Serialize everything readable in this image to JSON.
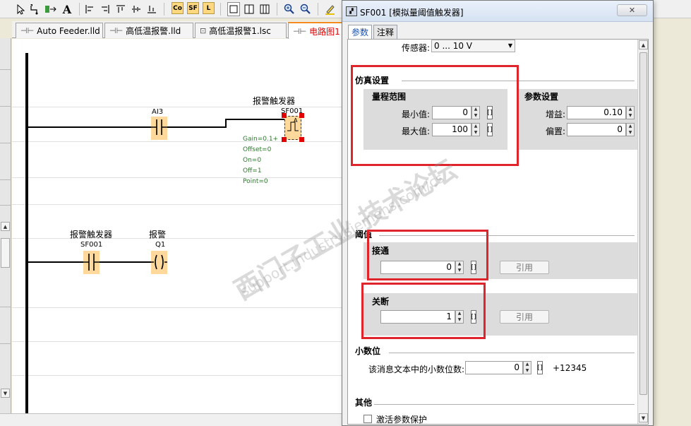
{
  "toolbar": {
    "text_tool": "A",
    "co_label": "Co",
    "sf_label": "SF",
    "l_label": "L"
  },
  "tabs": [
    {
      "label": "Auto Feeder.lld"
    },
    {
      "label": "高低温报警.lld"
    },
    {
      "label": "高低温报警1.lsc"
    },
    {
      "label": "电路图1"
    }
  ],
  "circuit": {
    "rung1": {
      "input_label": "AI3",
      "block_title": "报警触发器",
      "block_id": "SF001",
      "block_symbol": "A",
      "params": [
        "Gain=0.1+",
        "Offset=0",
        "On=0",
        "Off=1",
        "Point=0"
      ]
    },
    "rung2": {
      "contact_title": "报警触发器",
      "contact_id": "SF001",
      "coil_title": "报警",
      "coil_id": "Q1"
    }
  },
  "dialog": {
    "title": "SF001 [模拟量阈值触发器]",
    "close_glyph": "✕",
    "tabs": [
      {
        "label": "参数"
      },
      {
        "label": "注释"
      }
    ],
    "sensor_label": "传感器:",
    "sensor_value": "0 ... 10 V",
    "sim": {
      "title": "仿真设置",
      "range_title": "量程范围",
      "min_label": "最小值:",
      "min_value": "0",
      "max_label": "最大值:",
      "max_value": "100",
      "param_title": "参数设置",
      "gain_label": "增益:",
      "gain_value": "0.10",
      "offset_label": "偏置:",
      "offset_value": "0"
    },
    "threshold": {
      "title": "阈值",
      "on_title": "接通",
      "on_value": "0",
      "off_title": "关断",
      "off_value": "1",
      "ref_label": "引用"
    },
    "decimal": {
      "title": "小数位",
      "label": "该消息文本中的小数位数:",
      "value": "0",
      "preview": "+12345"
    },
    "other": {
      "title": "其他",
      "protect_label": "激活参数保护"
    }
  },
  "watermark": {
    "cn": "西门子工业  技术论坛",
    "url": "support.industry.siemens.com/cs"
  }
}
